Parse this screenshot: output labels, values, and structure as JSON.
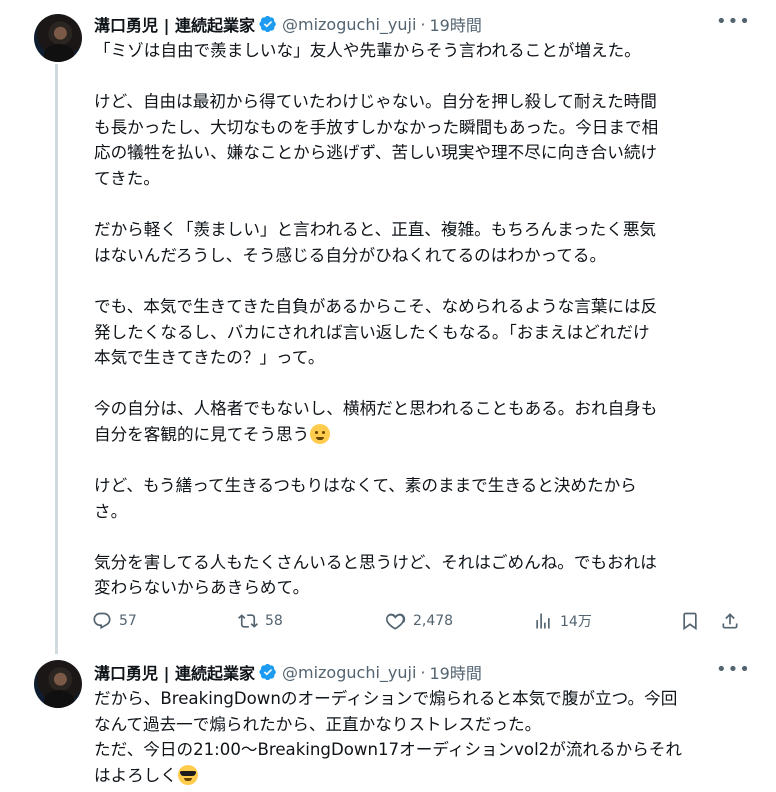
{
  "tweets": [
    {
      "author_name": "溝口勇児 | 連続起業家",
      "handle": "@mizoguchi_yuji",
      "separator": "·",
      "time": "19時間",
      "more_label": "•••",
      "lines": [
        "「ミゾは自由で羨ましいな」友人や先輩からそう言われることが増えた。",
        "",
        "けど、自由は最初から得ていたわけじゃない。自分を押し殺して耐えた時間",
        "も長かったし、大切なものを手放すしかなかった瞬間もあった。今日まで相",
        "応の犠牲を払い、嫌なことから逃げず、苦しい現実や理不尽に向き合い続け",
        "てきた。",
        "",
        "だから軽く「羨ましい」と言われると、正直、複雑。もちろんまったく悪気",
        "はないんだろうし、そう感じる自分がひねくれてるのはわかってる。",
        "",
        "でも、本気で生きてきた自負があるからこそ、なめられるような言葉には反",
        "発したくなるし、バカにされれば言い返したくもなる。「おまえはどれだけ",
        "本気で生きてきたの？」って。",
        "",
        "今の自分は、人格者でもないし、横柄だと思われることもある。おれ自身も",
        "自分を客観的に見てそう思う",
        "",
        "けど、もう繕って生きるつもりはなくて、素のままで生きると決めたから",
        "さ。",
        "",
        "気分を害してる人もたくさんいると思うけど、それはごめんね。でもおれは",
        "変わらないからあきらめて。"
      ],
      "emoji_after_line_index": 15,
      "emoji_name": "sweat-smile-emoji",
      "stats": {
        "replies": "57",
        "retweets": "58",
        "likes": "2,478",
        "views": "14万"
      }
    },
    {
      "author_name": "溝口勇児 | 連続起業家",
      "handle": "@mizoguchi_yuji",
      "separator": "·",
      "time": "19時間",
      "more_label": "•••",
      "lines": [
        "だから、BreakingDownのオーディションで煽られると本気で腹が立つ。今回",
        "なんて過去一で煽られたから、正直かなりストレスだった。",
        "ただ、今日の21:00〜BreakingDown17オーディションvol2が流れるからそれ",
        "はよろしく"
      ],
      "emoji_after_line_index": 3,
      "emoji_name": "sunglasses-emoji"
    }
  ],
  "icons": {
    "verified": "verified-badge-icon",
    "reply": "reply-icon",
    "retweet": "retweet-icon",
    "like": "heart-icon",
    "views": "views-icon",
    "bookmark": "bookmark-icon",
    "share": "share-icon"
  },
  "colors": {
    "text": "#0f1419",
    "muted": "#536471",
    "verified_blue": "#1d9bf0",
    "thread_line": "#cfd9de"
  }
}
